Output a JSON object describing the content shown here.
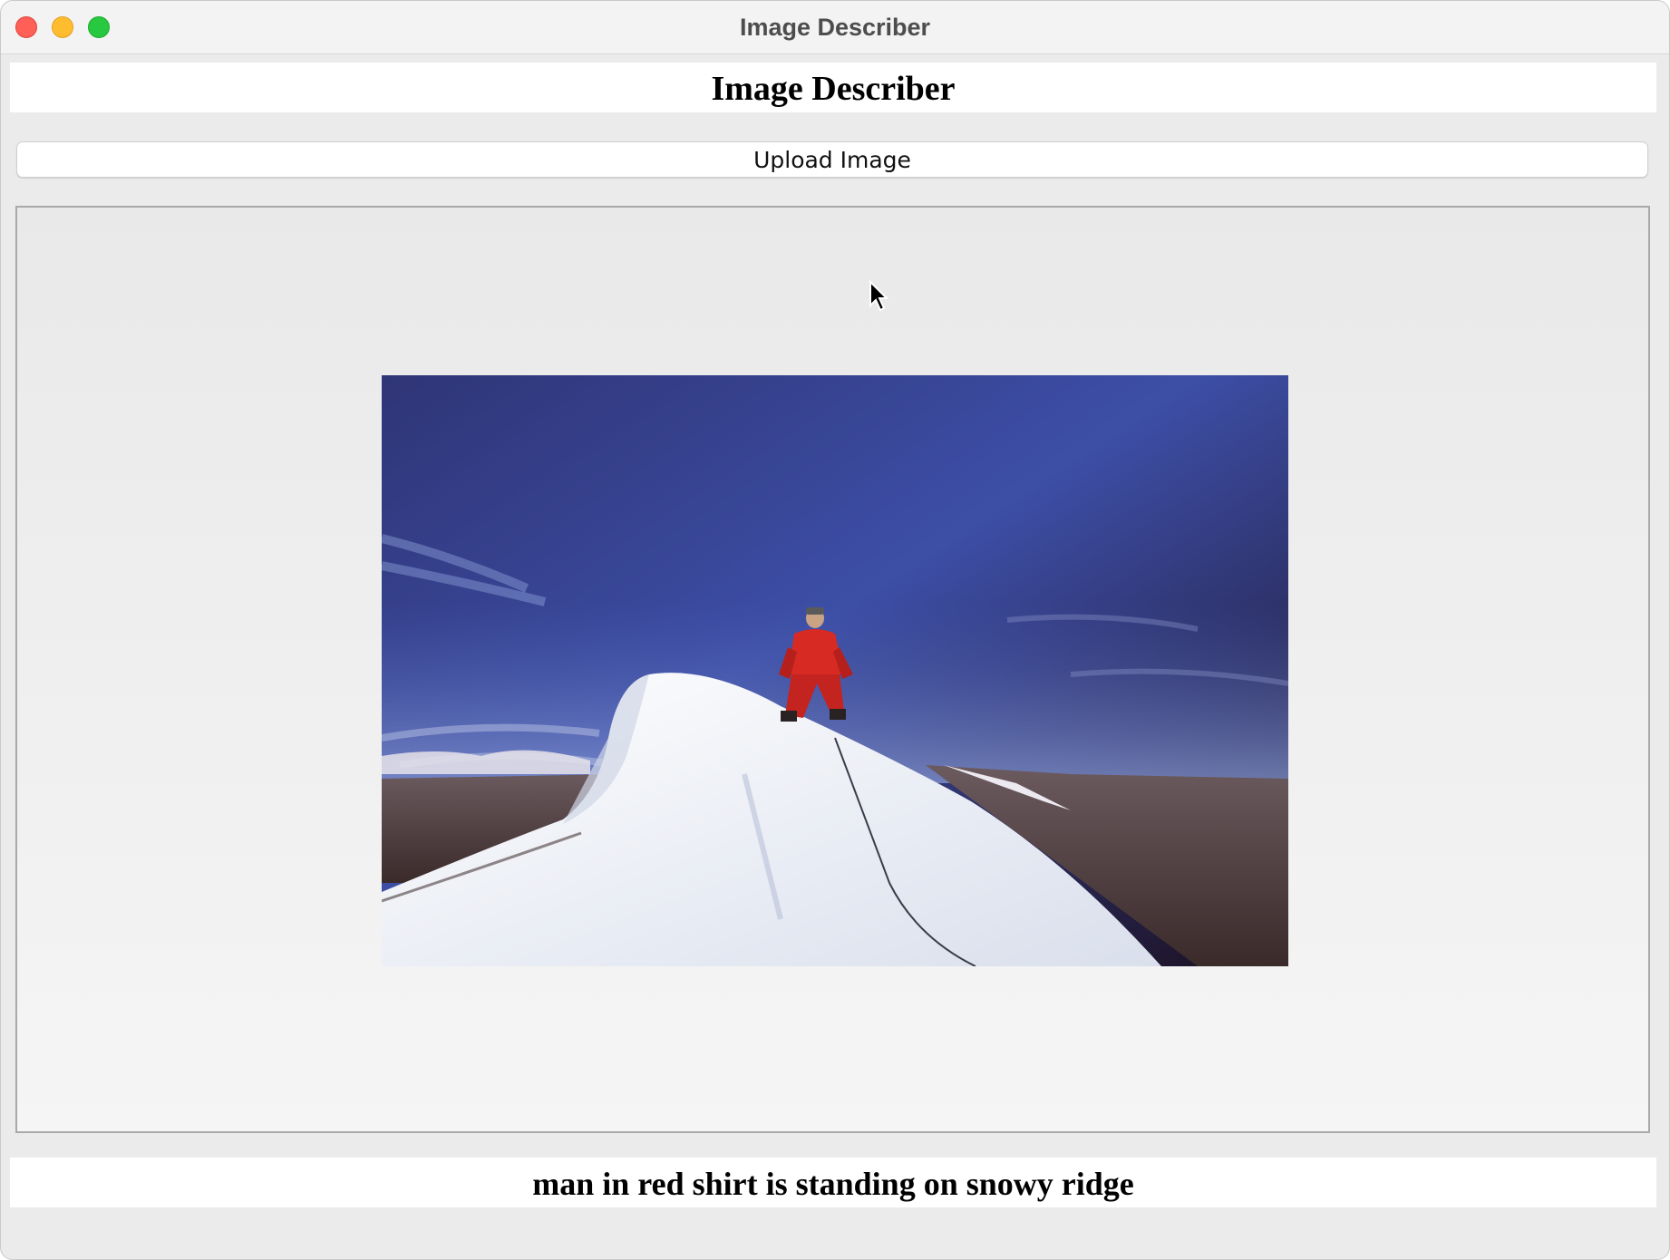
{
  "window": {
    "title": "Image Describer"
  },
  "app": {
    "header": "Image Describer",
    "upload_button_label": "Upload Image",
    "caption": "man in red shirt is standing on snowy ridge"
  },
  "colors": {
    "close": "#fe5f57",
    "minimize": "#febc2e",
    "maximize": "#28c840",
    "sky_top": "#2b2f6e",
    "jacket": "#d62a23",
    "snow": "#f2f4f8"
  },
  "icons": {
    "close": "close-icon",
    "minimize": "minimize-icon",
    "maximize": "maximize-icon",
    "cursor": "mouse-pointer-icon"
  }
}
